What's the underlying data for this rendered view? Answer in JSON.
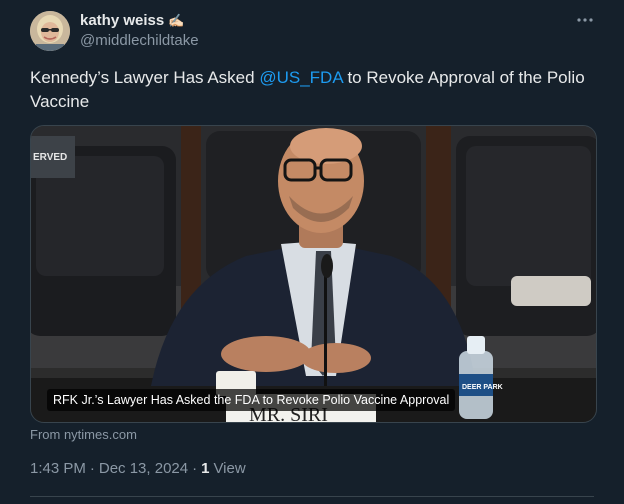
{
  "author": {
    "display_name": "kathy weiss",
    "handle": "@middlechildtake",
    "badge_emoji": "✍🏻"
  },
  "tweet": {
    "text_before": "Kennedy’s Lawyer Has Asked ",
    "mention": "@US_FDA",
    "text_after": " to Revoke Approval of the Polio Vaccine"
  },
  "media": {
    "caption": "RFK Jr.’s Lawyer Has Asked the FDA to Revoke Polio Vaccine Approval",
    "placard_text": "MR. SIRI",
    "background_sign_text": "ERVED",
    "bottle_label": "DEER PARK"
  },
  "card_source": "From nytimes.com",
  "meta": {
    "time": "1:43 PM",
    "separator": "·",
    "date": "Dec 13, 2024",
    "views_count": "1",
    "views_label": "View"
  },
  "colors": {
    "background": "#15202b",
    "text_primary": "#e7e9ea",
    "text_secondary": "#8b98a5",
    "link": "#1d9bf0"
  },
  "icons": {
    "more": "more-horizontal-icon"
  }
}
